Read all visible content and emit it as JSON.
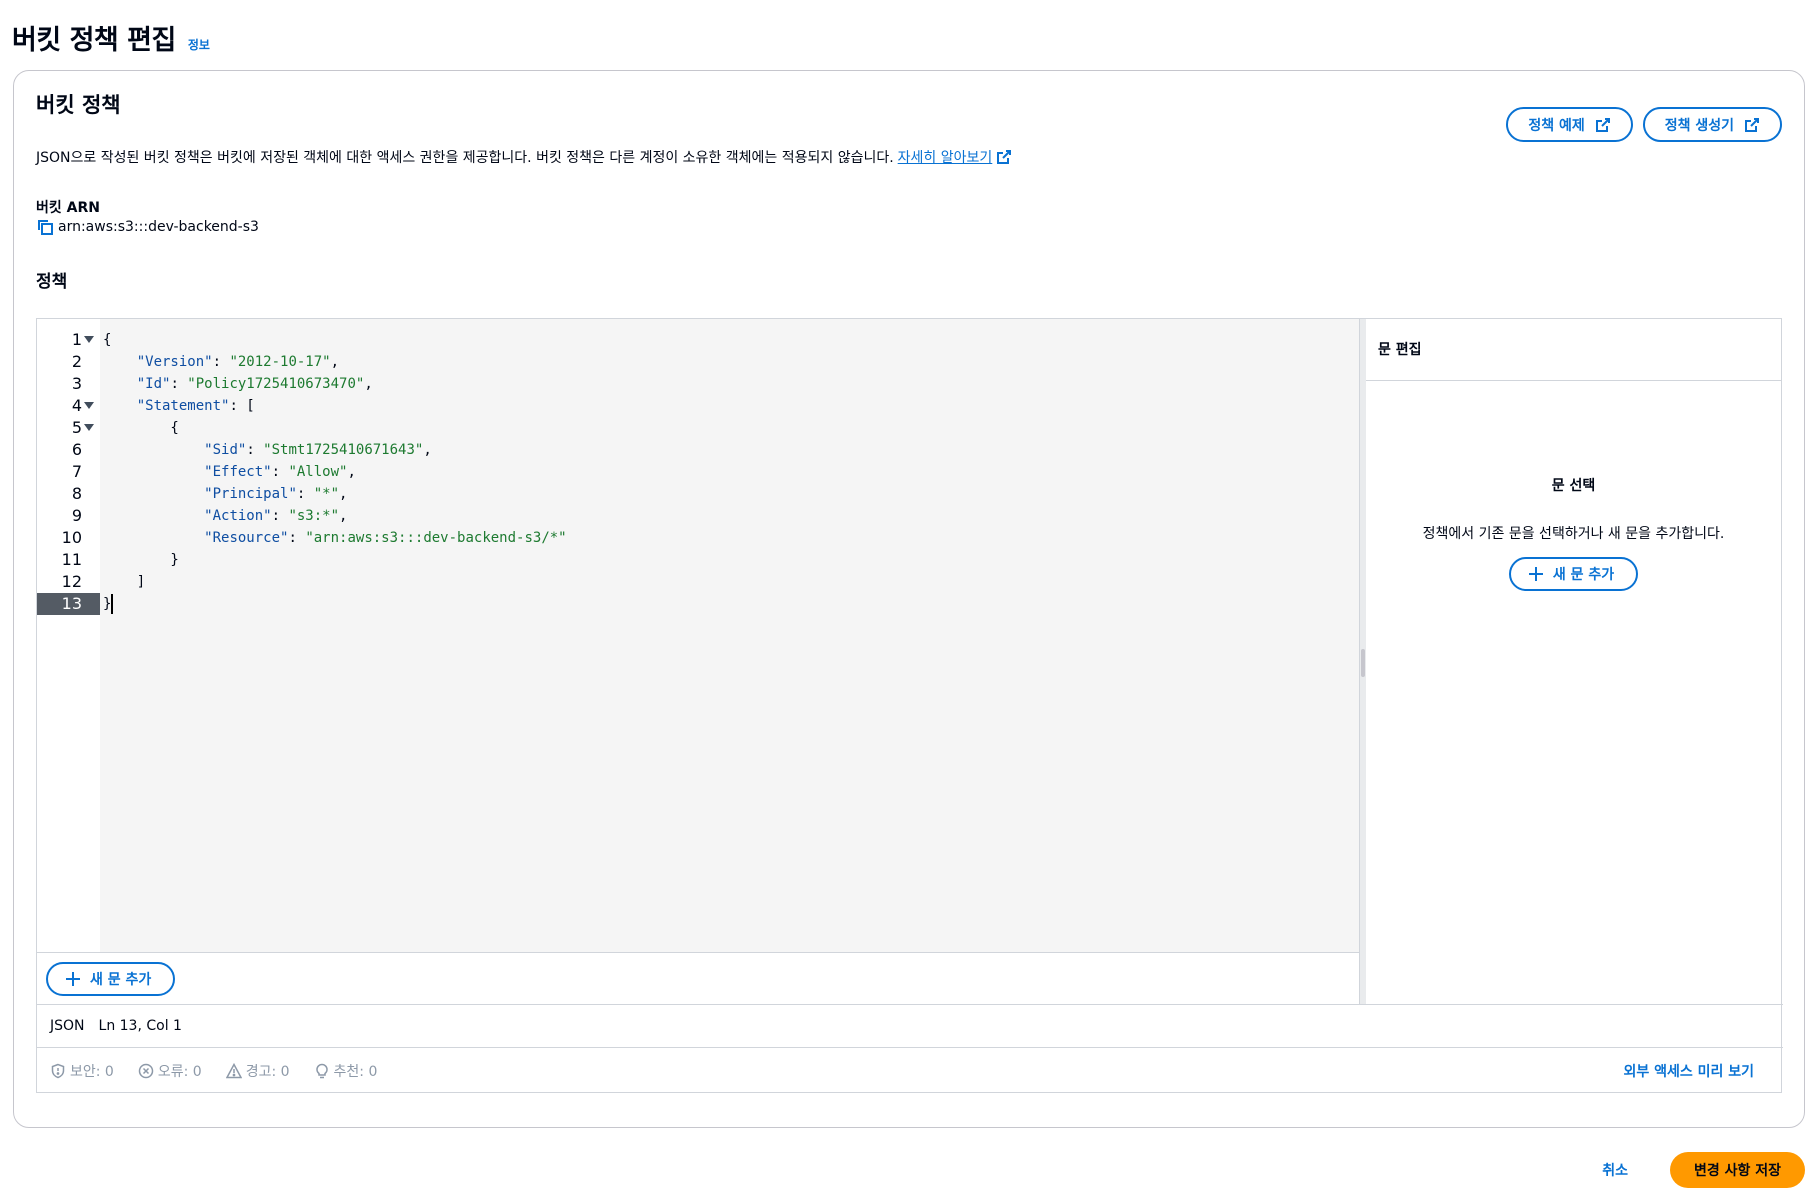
{
  "page": {
    "title": "버킷 정책 편집",
    "info_link": "정보"
  },
  "panel": {
    "heading": "버킷 정책",
    "description": "JSON으로 작성된 버킷 정책은 버킷에 저장된 객체에 대한 액세스 권한을 제공합니다. 버킷 정책은 다른 계정이 소유한 객체에는 적용되지 않습니다.",
    "learn_more": "자세히 알아보기",
    "examples_button": "정책 예제",
    "generator_button": "정책 생성기",
    "arn_label": "버킷 ARN",
    "arn_value": "arn:aws:s3:::dev-backend-s3",
    "policy_label": "정책"
  },
  "editor": {
    "lines": [
      {
        "n": "1",
        "fold": true,
        "tokens": [
          {
            "t": "{",
            "c": "p"
          }
        ]
      },
      {
        "n": "2",
        "fold": false,
        "tokens": [
          {
            "t": "    ",
            "c": "p"
          },
          {
            "t": "\"Version\"",
            "c": "key"
          },
          {
            "t": ": ",
            "c": "p"
          },
          {
            "t": "\"2012-10-17\"",
            "c": "str"
          },
          {
            "t": ",",
            "c": "p"
          }
        ]
      },
      {
        "n": "3",
        "fold": false,
        "tokens": [
          {
            "t": "    ",
            "c": "p"
          },
          {
            "t": "\"Id\"",
            "c": "key"
          },
          {
            "t": ": ",
            "c": "p"
          },
          {
            "t": "\"Policy1725410673470\"",
            "c": "str"
          },
          {
            "t": ",",
            "c": "p"
          }
        ]
      },
      {
        "n": "4",
        "fold": true,
        "tokens": [
          {
            "t": "    ",
            "c": "p"
          },
          {
            "t": "\"Statement\"",
            "c": "key"
          },
          {
            "t": ": [",
            "c": "p"
          }
        ]
      },
      {
        "n": "5",
        "fold": true,
        "tokens": [
          {
            "t": "        {",
            "c": "p"
          }
        ]
      },
      {
        "n": "6",
        "fold": false,
        "tokens": [
          {
            "t": "            ",
            "c": "p"
          },
          {
            "t": "\"Sid\"",
            "c": "key"
          },
          {
            "t": ": ",
            "c": "p"
          },
          {
            "t": "\"Stmt1725410671643\"",
            "c": "str"
          },
          {
            "t": ",",
            "c": "p"
          }
        ]
      },
      {
        "n": "7",
        "fold": false,
        "tokens": [
          {
            "t": "            ",
            "c": "p"
          },
          {
            "t": "\"Effect\"",
            "c": "key"
          },
          {
            "t": ": ",
            "c": "p"
          },
          {
            "t": "\"Allow\"",
            "c": "str"
          },
          {
            "t": ",",
            "c": "p"
          }
        ]
      },
      {
        "n": "8",
        "fold": false,
        "tokens": [
          {
            "t": "            ",
            "c": "p"
          },
          {
            "t": "\"Principal\"",
            "c": "key"
          },
          {
            "t": ": ",
            "c": "p"
          },
          {
            "t": "\"*\"",
            "c": "str"
          },
          {
            "t": ",",
            "c": "p"
          }
        ]
      },
      {
        "n": "9",
        "fold": false,
        "tokens": [
          {
            "t": "            ",
            "c": "p"
          },
          {
            "t": "\"Action\"",
            "c": "key"
          },
          {
            "t": ": ",
            "c": "p"
          },
          {
            "t": "\"s3:*\"",
            "c": "str"
          },
          {
            "t": ",",
            "c": "p"
          }
        ]
      },
      {
        "n": "10",
        "fold": false,
        "tokens": [
          {
            "t": "            ",
            "c": "p"
          },
          {
            "t": "\"Resource\"",
            "c": "key"
          },
          {
            "t": ": ",
            "c": "p"
          },
          {
            "t": "\"arn:aws:s3:::dev-backend-s3/*\"",
            "c": "str"
          }
        ]
      },
      {
        "n": "11",
        "fold": false,
        "tokens": [
          {
            "t": "        }",
            "c": "p"
          }
        ]
      },
      {
        "n": "12",
        "fold": false,
        "tokens": [
          {
            "t": "    ]",
            "c": "p"
          }
        ]
      },
      {
        "n": "13",
        "fold": false,
        "active": true,
        "tokens": [
          {
            "t": "}",
            "c": "p"
          }
        ]
      }
    ],
    "add_statement_button": "새 문 추가",
    "status_mode": "JSON",
    "status_position": "Ln 13, Col 1"
  },
  "side_panel": {
    "heading": "문 편집",
    "empty_title": "문 선택",
    "empty_text": "정책에서 기존 문을 선택하거나 새 문을 추가합니다.",
    "add_button": "새 문 추가"
  },
  "issues": {
    "security": "보안: 0",
    "errors": "오류: 0",
    "warnings": "경고: 0",
    "suggestions": "추천: 0",
    "external_access_preview": "외부 액세스 미리 보기"
  },
  "footer": {
    "cancel": "취소",
    "save": "변경 사항 저장"
  },
  "colors": {
    "accent": "#0972d3",
    "primary_button": "#ff9900",
    "key_token": "#0f4ea2",
    "string_token": "#1d7a30"
  }
}
